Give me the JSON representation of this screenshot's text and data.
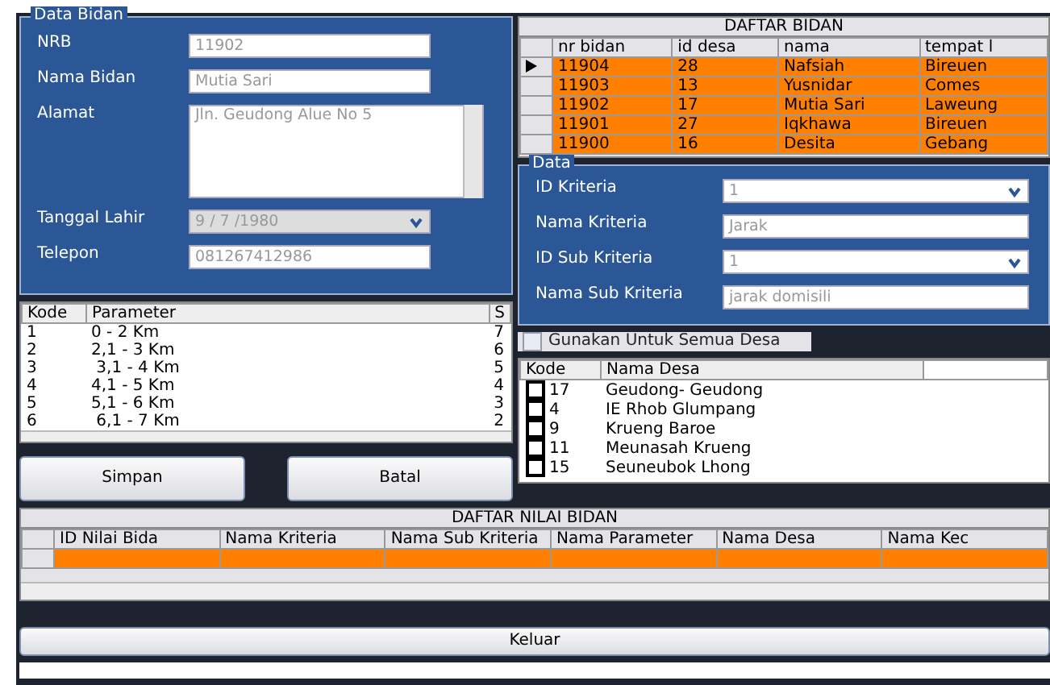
{
  "data_bidan": {
    "title": "Data Bidan",
    "fields": [
      {
        "label": "NRB",
        "value": "11902",
        "kind": "text"
      },
      {
        "label": "Nama Bidan",
        "value": "Mutia Sari",
        "kind": "text"
      },
      {
        "label": "Alamat",
        "value": "Jln. Geudong Alue No 5",
        "kind": "textarea"
      },
      {
        "label": "Tanggal Lahir",
        "value": "9 / 7 /1980",
        "kind": "date"
      },
      {
        "label": "Telepon",
        "value": "081267412986",
        "kind": "text"
      }
    ]
  },
  "daftar_bidan": {
    "title": "DAFTAR BIDAN",
    "columns": [
      "nr bidan",
      "id desa",
      "nama",
      "tempat l"
    ],
    "rows": [
      {
        "cells": [
          "11904",
          "28",
          "Nafsiah",
          "Bireuen"
        ],
        "current": true
      },
      {
        "cells": [
          "11903",
          "13",
          "Yusnidar",
          "Comes"
        ],
        "current": false
      },
      {
        "cells": [
          "11902",
          "17",
          "Mutia Sari",
          "Laweung"
        ],
        "current": false
      },
      {
        "cells": [
          "11901",
          "27",
          "Iqkhawa",
          "Bireuen"
        ],
        "current": false
      },
      {
        "cells": [
          "11900",
          "16",
          "Desita",
          "Gebang"
        ],
        "current": false
      }
    ]
  },
  "parameter_list": {
    "columns": [
      "Kode",
      "Parameter",
      "S"
    ],
    "rows": [
      [
        "1",
        "0 - 2 Km",
        "7"
      ],
      [
        "2",
        "2,1 - 3 Km",
        "6"
      ],
      [
        "3",
        " 3,1 - 4 Km",
        "5"
      ],
      [
        "4",
        "4,1 - 5 Km",
        "4"
      ],
      [
        "5",
        "5,1 - 6 Km",
        "3"
      ],
      [
        "6",
        " 6,1 - 7 Km",
        "2"
      ]
    ]
  },
  "buttons": [
    "Simpan",
    "Batal"
  ],
  "data": {
    "title": "Data",
    "fields": [
      {
        "label": "ID Kriteria",
        "value": "1",
        "kind": "combo"
      },
      {
        "label": "Nama Kriteria",
        "value": "Jarak",
        "kind": "text"
      },
      {
        "label": "ID Sub Kriteria",
        "value": "1",
        "kind": "combo"
      },
      {
        "label": "Nama Sub Kriteria",
        "value": "jarak domisili",
        "kind": "text"
      }
    ]
  },
  "semua_desa": {
    "label": "Gunakan Untuk Semua Desa",
    "checked": false
  },
  "desa_list": {
    "columns": [
      "Kode",
      "Nama Desa"
    ],
    "rows": [
      {
        "kode": "17",
        "nama": "Geudong- Geudong",
        "checked": false
      },
      {
        "kode": "4",
        "nama": "IE Rhob Glumpang",
        "checked": false
      },
      {
        "kode": "9",
        "nama": "Krueng Baroe",
        "checked": false
      },
      {
        "kode": "11",
        "nama": "Meunasah Krueng",
        "checked": false
      },
      {
        "kode": "15",
        "nama": "Seuneubok Lhong",
        "checked": false
      }
    ]
  },
  "daftar_nilai": {
    "title": "DAFTAR NILAI BIDAN",
    "columns": [
      "ID Nilai Bida",
      "Nama Kriteria",
      "Nama Sub Kriteria",
      "Nama Parameter",
      "Nama Desa",
      "Nama Kec"
    ]
  },
  "exit_button": "Keluar"
}
